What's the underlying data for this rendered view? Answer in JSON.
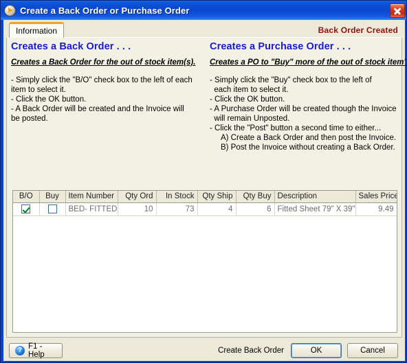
{
  "window": {
    "title": "Create a Back Order or Purchase Order",
    "app_icon": "play-badge-icon",
    "close_icon": "close-icon",
    "accent_blue": "#0a46d2",
    "status_color": "#8b1410",
    "heading_color": "#1a1ad2"
  },
  "tabs": [
    {
      "label": "Information",
      "active": true
    }
  ],
  "status": {
    "label": "Back Order Created"
  },
  "panels": {
    "left": {
      "heading": "Creates a Back Order . . .",
      "subheading": "Creates a Back Order for the out of stock item(s).",
      "body": "- Simply click the \"B/O\" check box to the left of each\nitem to select it.\n- Click the OK button.\n- A Back Order will be created and the Invoice will\nbe posted."
    },
    "right": {
      "heading": "Creates a Purchase Order . . .",
      "subheading": "Creates a PO to \"Buy\" more of the out of stock item's)",
      "body": "- Simply click the \"Buy\" check box to the left of\n  each item to select it.\n- Click the OK button.\n- A Purchase Order will be created though the Invoice\n  will remain Unposted.\n- Click the \"Post\" button a second time to either...\n     A) Create a Back Order and then post the Invoice.\n     B) Post the Invoice without creating a Back Order."
    }
  },
  "grid": {
    "columns": [
      {
        "key": "bo",
        "label": "B/O",
        "align": "c"
      },
      {
        "key": "buy",
        "label": "Buy",
        "align": "c"
      },
      {
        "key": "item_number",
        "label": "Item Number",
        "align": "l"
      },
      {
        "key": "qty_ord",
        "label": "Qty Ord",
        "align": "r"
      },
      {
        "key": "in_stock",
        "label": "In Stock",
        "align": "r"
      },
      {
        "key": "qty_ship",
        "label": "Qty Ship",
        "align": "r"
      },
      {
        "key": "qty_buy",
        "label": "Qty Buy",
        "align": "r"
      },
      {
        "key": "description",
        "label": "Description",
        "align": "l"
      },
      {
        "key": "blank",
        "label": "",
        "align": "l"
      },
      {
        "key": "sales_price",
        "label": "Sales Price",
        "align": "r"
      }
    ],
    "rows": [
      {
        "bo": true,
        "buy": false,
        "item_number": "BED- FITTED",
        "qty_ord": "10",
        "in_stock": "73",
        "qty_ship": "4",
        "qty_buy": "6",
        "description": "Fitted Sheet 79\" X 39\"",
        "blank": "",
        "sales_price": "9.49"
      }
    ]
  },
  "footer": {
    "help_label": "F1 - Help",
    "help_icon": "question-mark-icon",
    "create_back_order_label": "Create Back Order",
    "ok_label": "OK",
    "cancel_label": "Cancel"
  }
}
